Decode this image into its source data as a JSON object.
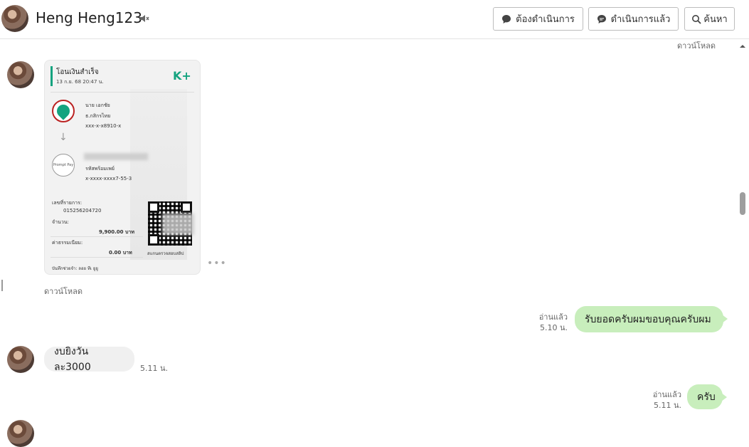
{
  "header": {
    "contact_name": "Heng Heng123",
    "buttons": {
      "todo": "ต้องดำเนินการ",
      "done": "ดำเนินการแล้ว",
      "search": "ค้นหา"
    }
  },
  "messages": {
    "top_download": "ดาวน์โหลด",
    "receipt": {
      "title": "โอนเงินสำเร็จ",
      "date": "13 ก.ย. 68 20:47 น.",
      "brand": "K+",
      "sender_name": "นาย เอกชัย",
      "sender_bank": "ธ.กสิกรไทย",
      "sender_acct": "xxx-x-x8910-x",
      "promptpay_label": "Prompt Pay",
      "receiver_type": "รหัสพร้อมเพย์",
      "receiver_acct": "x-xxxx-xxxx7-55-3",
      "ref_label": "เลขที่รายการ:",
      "ref_value": "015256204720",
      "amount_label": "จำนวน:",
      "amount_value": "9,900.00 บาท",
      "fee_label": "ค่าธรรมเนียม:",
      "fee_value": "0.00 บาท",
      "qr_caption": "สแกนตรวจสอบสลิป",
      "memo": "บันทึกช่วยจำ: ลอย ทีเ ยูยู"
    },
    "receipt_download": "ดาวน์โหลด",
    "more_dots": "•••",
    "out1": {
      "text": "รับยอดครับผมขอบคุณครับผม",
      "read": "อ่านแล้ว",
      "time": "5.10 น."
    },
    "in1": {
      "text": "งบยิงวันละ3000",
      "time": "5.11 น."
    },
    "out2": {
      "text": "ครับ",
      "read": "อ่านแล้ว",
      "time": "5.11 น."
    }
  },
  "colors": {
    "accent_green": "#14a37f",
    "outgoing_bubble": "#c8eebc",
    "incoming_bubble": "#f0f0f0"
  },
  "icons": [
    "mute-icon",
    "chat-bubble-icon",
    "search-icon",
    "scroll-up-icon"
  ]
}
